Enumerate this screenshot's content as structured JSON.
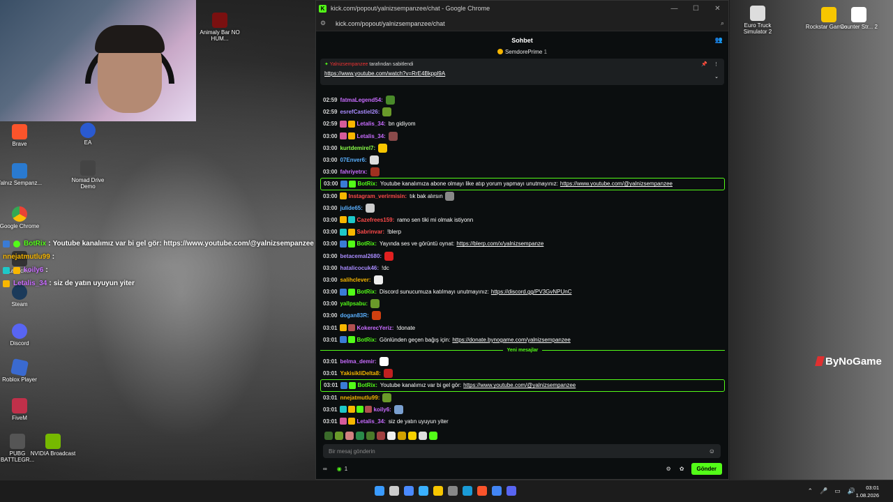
{
  "desktop": {
    "icons_left": [
      {
        "label": "Animaly Bar NO HUM..."
      },
      {
        "label": "Brave"
      },
      {
        "label": "EA"
      },
      {
        "label": "Yalnız Sempanz..."
      },
      {
        "label": "Nomad Drive Demo"
      },
      {
        "label": "Google Chrome"
      },
      {
        "label": "Launcher"
      },
      {
        "label": "Steam"
      },
      {
        "label": "Discord"
      },
      {
        "label": "Roblox Player"
      },
      {
        "label": "FiveM"
      },
      {
        "label": "PUBG BATTLEGR..."
      },
      {
        "label": "NVIDIA Broadcast"
      }
    ],
    "icons_right": [
      {
        "label": "Euro Truck Simulator 2"
      },
      {
        "label": "Rockstar Games..."
      },
      {
        "label": "Counter Str... 2"
      }
    ],
    "overlay": [
      {
        "user": "BotRix",
        "text": "Youtube kanalımız var bi gel gör: https://www.youtube.com/@yalnizsempanzee"
      },
      {
        "user": "nnejatmutlu99",
        "text": ""
      },
      {
        "user": "koily6",
        "text": ""
      },
      {
        "user": "Letalis_34",
        "text": "siz de yatın uyuyun yiter"
      }
    ],
    "brand": "ByNoGame"
  },
  "chrome": {
    "title": "kick.com/popout/yalnizsempanzee/chat - Google Chrome",
    "url": "kick.com/popout/yalnizsempanzee/chat",
    "controls": [
      "—",
      "☐",
      "✕"
    ]
  },
  "chat": {
    "header": "Sohbet",
    "sub_user": "SemdorePrime",
    "sub_count": "1",
    "pinned_by_user": "Yalnizsempanzee",
    "pinned_by_suffix": "tarafından sabitlendi",
    "pinned_link": "https://www.youtube.com/watch?v=RrE4Bkppl9A",
    "messages": [
      {
        "time": "02:59",
        "user": "fatmaLegend54",
        "color": "#c86cff",
        "text": "",
        "emote": "#4a8a2a"
      },
      {
        "time": "02:59",
        "user": "esrefCastiel26",
        "color": "#a98bff",
        "text": "",
        "emote": "#6a9a2a"
      },
      {
        "time": "02:59",
        "user": "Letalis_34",
        "color": "#c86cff",
        "text": "bn gidiyom",
        "badges": [
          "#d65b9a",
          "#f7b600"
        ]
      },
      {
        "time": "03:00",
        "user": "Letalis_34",
        "color": "#c86cff",
        "text": "",
        "badges": [
          "#d65b9a",
          "#f7b600"
        ],
        "emote": "#8a4a4a"
      },
      {
        "time": "03:00",
        "user": "kurtdemirel7",
        "color": "#8aff4a",
        "text": "",
        "emote": "#f7c600"
      },
      {
        "time": "03:00",
        "user": "07Enver6",
        "color": "#5ab0ff",
        "text": "",
        "emote": "#dddddd"
      },
      {
        "time": "03:00",
        "user": "fahriyetrx",
        "color": "#c86cff",
        "text": "",
        "emote": "#a03020"
      },
      {
        "time": "03:00",
        "user": "BotRix",
        "color": "#53fc18",
        "text": "Youtube kanalımıza abone olmayı like atıp yorum yapmayı unutmayınız:",
        "link": "https://www.youtube.com/@yalnizsempanzee",
        "highlight": true,
        "badges": [
          "#3a7bd5",
          "#53fc18"
        ]
      },
      {
        "time": "03:00",
        "user": "Instagram_verirmisin",
        "color": "#ff4a4a",
        "text": "tık bak alırsın",
        "badges": [
          "#f7b600"
        ],
        "emote": "#888888"
      },
      {
        "time": "03:00",
        "user": "julide65",
        "color": "#5ab0ff",
        "text": "",
        "emote": "#cccccc"
      },
      {
        "time": "03:00",
        "user": "Cazefrees159",
        "color": "#ff4a4a",
        "text": "ramo sen tiki mi olmak istiyonn",
        "badges": [
          "#f7b600",
          "#1ec8c8"
        ]
      },
      {
        "time": "03:00",
        "user": "Sabrinvar",
        "color": "#ff4a4a",
        "text": "!blerp",
        "badges": [
          "#1ec8c8",
          "#f7b600"
        ]
      },
      {
        "time": "03:00",
        "user": "BotRix",
        "color": "#53fc18",
        "text": "Yayında ses ve görüntü oynat:",
        "link": "https://blerp.com/x/yalnizsempanze",
        "badges": [
          "#3a7bd5",
          "#53fc18"
        ]
      },
      {
        "time": "03:00",
        "user": "betacemal2680",
        "color": "#a98bff",
        "text": "",
        "emote": "#e02020"
      },
      {
        "time": "03:00",
        "user": "hatalicocuk46",
        "color": "#a98bff",
        "text": "!dc"
      },
      {
        "time": "03:00",
        "user": "salihclever",
        "color": "#f7b600",
        "text": "",
        "emote": "#eeeeee"
      },
      {
        "time": "03:00",
        "user": "BotRix",
        "color": "#53fc18",
        "text": "Discord sunucumuza katılmayı unutmayınız:",
        "link": "https://discord.gg/PV3GvNPUnC",
        "badges": [
          "#3a7bd5",
          "#53fc18"
        ]
      },
      {
        "time": "03:00",
        "user": "yallpsabu",
        "color": "#53fc18",
        "text": "",
        "emote": "#6a9a2a"
      },
      {
        "time": "03:00",
        "user": "dogan83R",
        "color": "#5ab0ff",
        "text": "",
        "emote": "#d04010"
      },
      {
        "time": "03:01",
        "user": "KokerecYeriz",
        "color": "#c86cff",
        "text": "!donate",
        "badges": [
          "#f7b600",
          "#b05050"
        ]
      },
      {
        "time": "03:01",
        "user": "BotRix",
        "color": "#53fc18",
        "text": "Gönlünden geçen bağış için:",
        "link": "https://donate.bynogame.com/yalnizsempanzee",
        "badges": [
          "#3a7bd5",
          "#53fc18"
        ]
      }
    ],
    "separator": "Yeni mesajlar",
    "messages_new": [
      {
        "time": "03:01",
        "user": "belma_demir",
        "color": "#c86cff",
        "text": "",
        "emote": "#ffffff"
      },
      {
        "time": "03:01",
        "user": "YakisikliDelta8",
        "color": "#f7b600",
        "text": "",
        "emote": "#c02020"
      },
      {
        "time": "03:01",
        "user": "BotRix",
        "color": "#53fc18",
        "text": "Youtube kanalımız var bi gel gör:",
        "link": "https://www.youtube.com/@yalnizsempanzee",
        "highlight": true,
        "badges": [
          "#3a7bd5",
          "#53fc18"
        ]
      },
      {
        "time": "03:01",
        "user": "nnejatmutlu99",
        "color": "#f7b600",
        "text": "",
        "emote": "#6a9a2a"
      },
      {
        "time": "03:01",
        "user": "koily6",
        "color": "#c86cff",
        "text": "",
        "badges": [
          "#1ec8c8",
          "#f7b600",
          "#53fc18",
          "#b05050"
        ],
        "emote": "#7aa0d0"
      },
      {
        "time": "03:01",
        "user": "Letalis_34",
        "color": "#c86cff",
        "text": "siz de yatın uyuyun yiter",
        "badges": [
          "#d65b9a",
          "#f7b600"
        ]
      }
    ],
    "emote_row": [
      "#3a6a2a",
      "#6a9a2a",
      "#d08080",
      "#2a8a4a",
      "#4a7a2a",
      "#a04040",
      "#eeeeee",
      "#d0a000",
      "#f7d000",
      "#dddddd",
      "#53fc18"
    ],
    "input_placeholder": "Bir mesaj gönderin",
    "viewers_icon": "∞",
    "points": "1",
    "send_label": "Gönder"
  },
  "taskbar": {
    "time": "03:01",
    "date": "1.08.2026",
    "icons": [
      "#3a9bff",
      "#cccccc",
      "#4a8aff",
      "#3ab0ff",
      "#f7c600",
      "#888888",
      "#1a9bd7",
      "#fb542b",
      "#4285f4",
      "#5865f2"
    ]
  }
}
